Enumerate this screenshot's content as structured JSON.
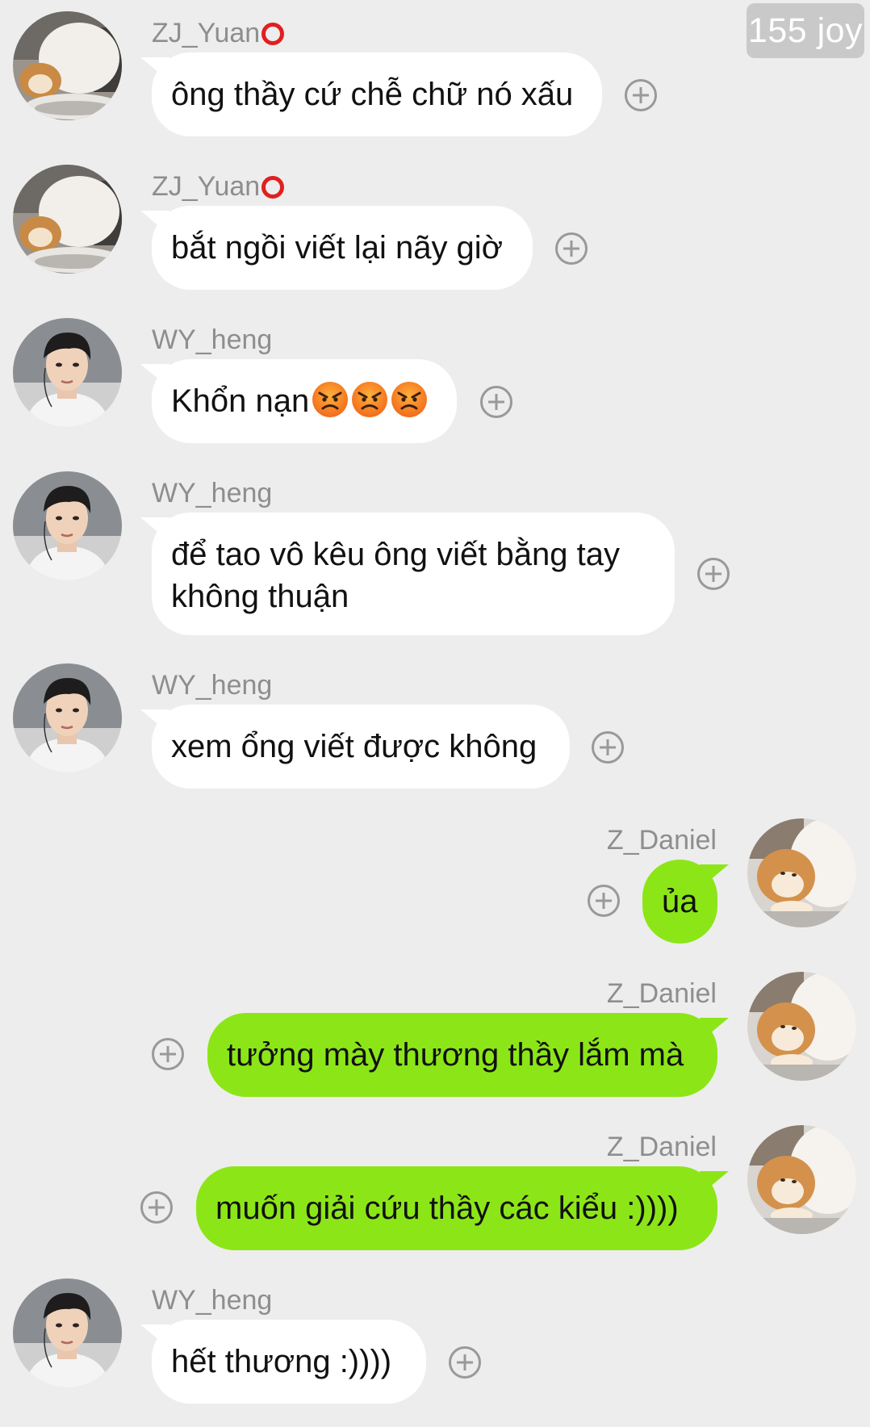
{
  "badge": {
    "text": "155 joy"
  },
  "messages": [
    {
      "sender": "ZJ_Yuan",
      "text": "ông thầy cứ chễ chữ nó xấu"
    },
    {
      "sender": "ZJ_Yuan",
      "text": "bắt ngồi viết lại nãy giờ"
    },
    {
      "sender": "WY_heng",
      "text": "Khổn nạn"
    },
    {
      "sender": "WY_heng",
      "text": "để tao vô kêu ông viết bằng tay không thuận"
    },
    {
      "sender": "WY_heng",
      "text": "xem ổng viết được không"
    },
    {
      "sender": "Z_Daniel",
      "text": "ủa"
    },
    {
      "sender": "Z_Daniel",
      "text": "tưởng mày thương thầy lắm mà"
    },
    {
      "sender": "Z_Daniel",
      "text": "muốn giải cứu thầy các kiểu :))))"
    },
    {
      "sender": "WY_heng",
      "text": "hết thương :))))"
    }
  ],
  "icons": {
    "add": "plus-circle-icon",
    "sender_badge": "red-circle-emoji",
    "angry": "angry-face-emoji"
  },
  "colors": {
    "background": "#ededed",
    "incoming_bubble": "#ffffff",
    "outgoing_bubble": "#8ce617",
    "sender_name": "#8e8e8e"
  }
}
